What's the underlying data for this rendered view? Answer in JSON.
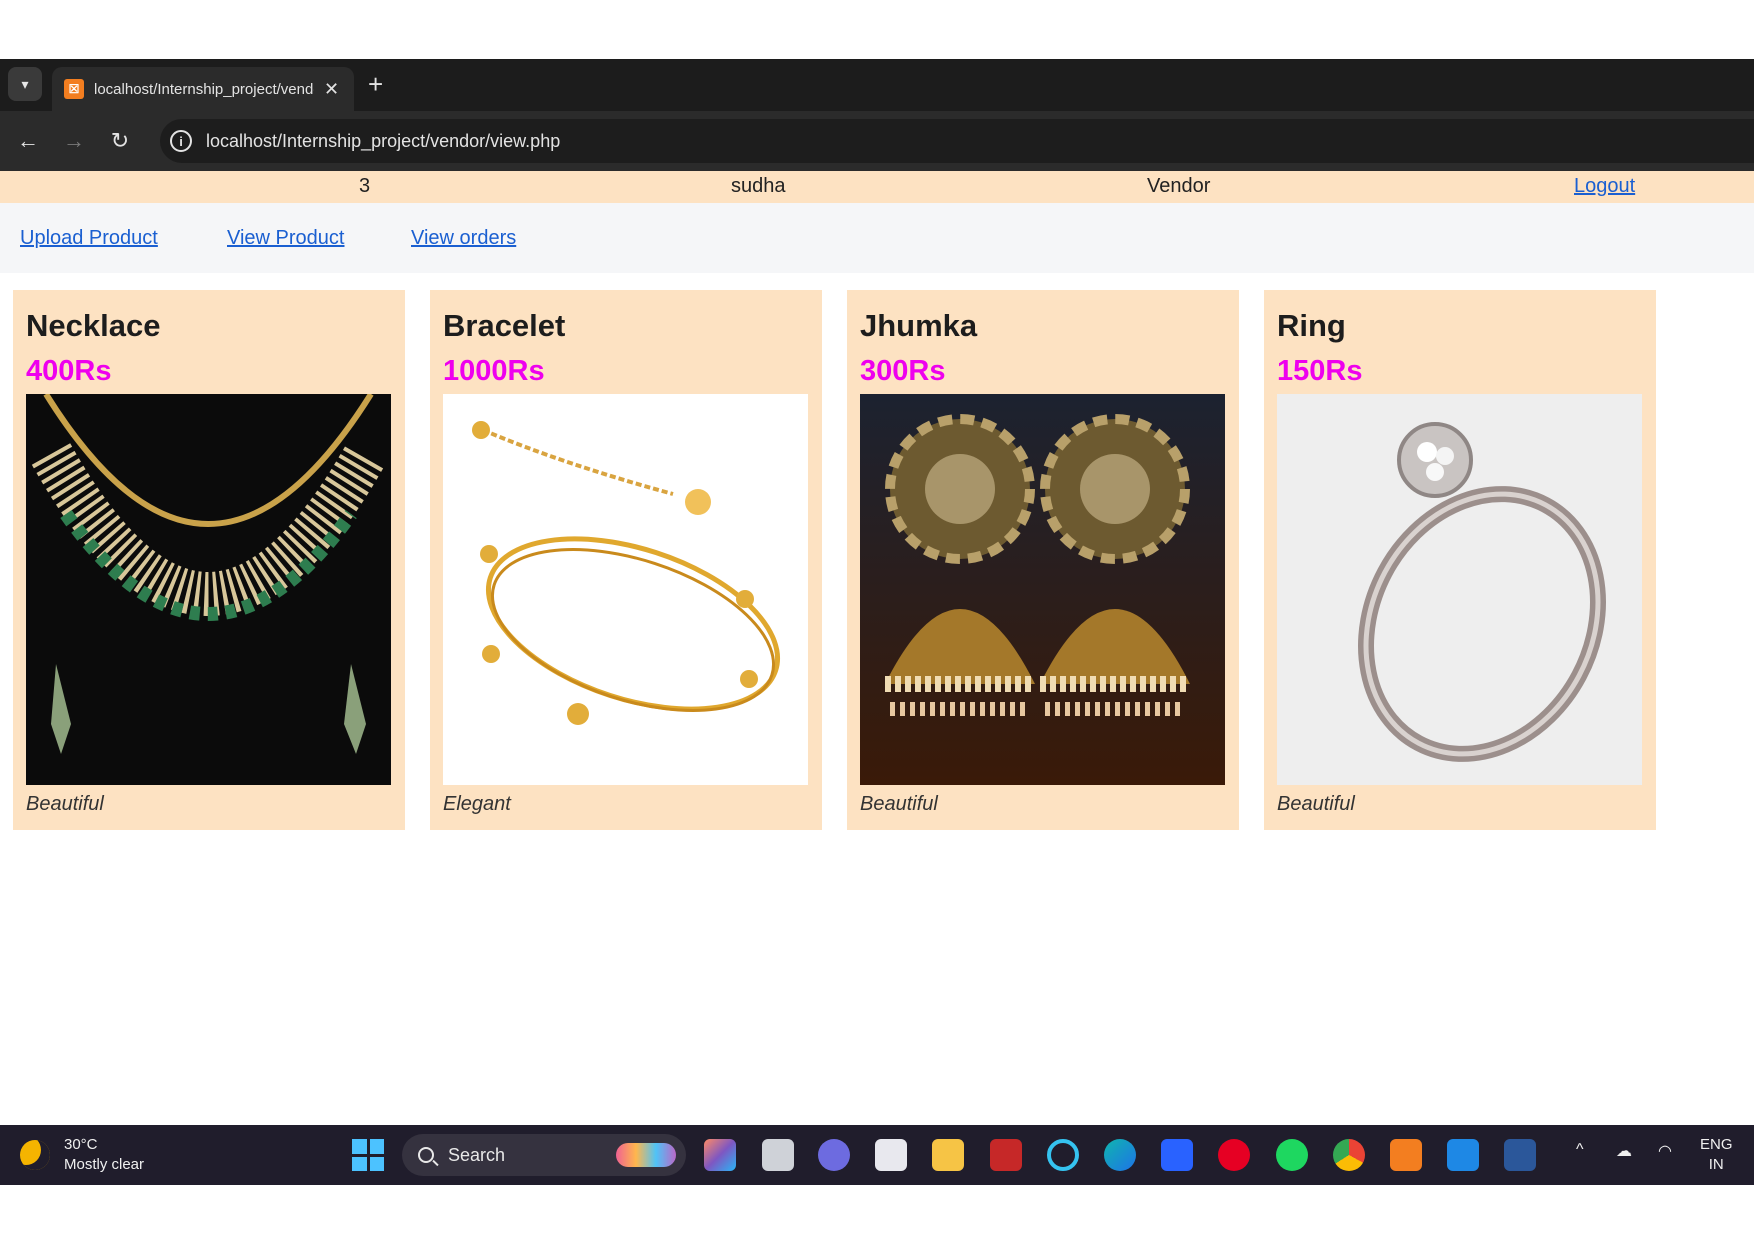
{
  "browser": {
    "tab_title": "localhost/Internship_project/vendor/view.php",
    "url": "localhost/Internship_project/vendor/view.php"
  },
  "userbar": {
    "id": "3",
    "username": "sudha",
    "role": "Vendor",
    "logout": "Logout"
  },
  "nav": {
    "upload": "Upload Product",
    "view": "View Product",
    "orders": "View orders"
  },
  "products": [
    {
      "name": "Necklace",
      "price": "400Rs",
      "desc": "Beautiful",
      "image": "necklace-image"
    },
    {
      "name": "Bracelet",
      "price": "1000Rs",
      "desc": "Elegant",
      "image": "bracelet-image"
    },
    {
      "name": "Jhumka",
      "price": "300Rs",
      "desc": "Beautiful",
      "image": "jhumka-image"
    },
    {
      "name": "Ring",
      "price": "150Rs",
      "desc": "Beautiful",
      "image": "ring-image"
    }
  ],
  "taskbar": {
    "temperature": "30°C",
    "weather": "Mostly clear",
    "search": "Search",
    "lang": "ENG",
    "region": "IN"
  },
  "colors": {
    "card_bg": "#fde2c2",
    "price": "#ee00ee",
    "link": "#1a5fd1"
  }
}
